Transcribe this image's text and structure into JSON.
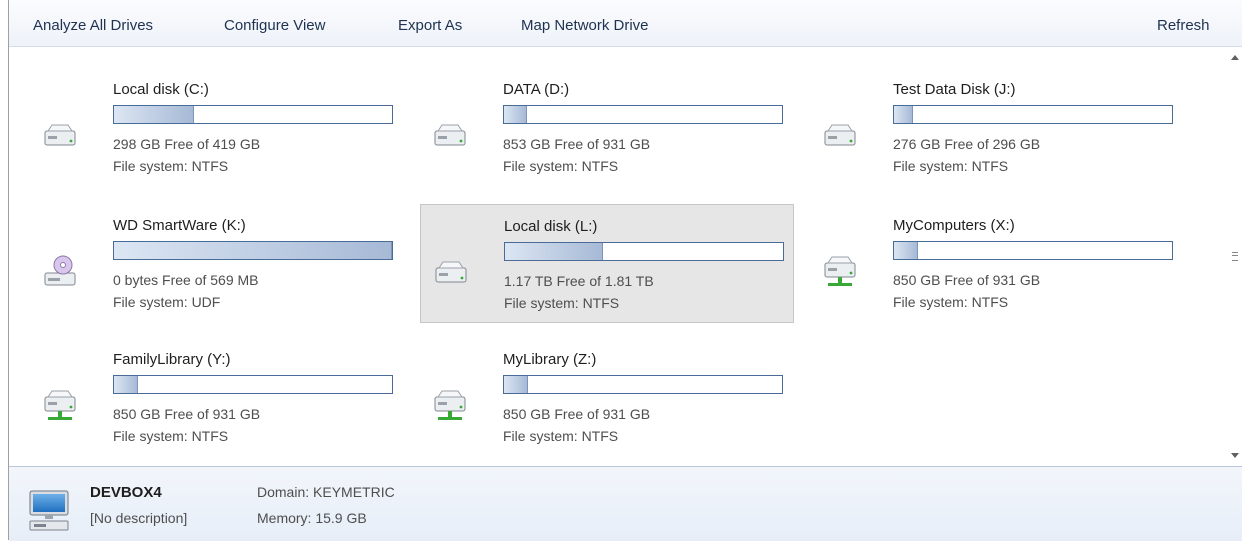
{
  "toolbar": {
    "analyze": "Analyze All Drives",
    "configure": "Configure View",
    "export": "Export As",
    "map": "Map Network Drive",
    "refresh": "Refresh"
  },
  "drives": [
    {
      "name": "Local disk (C:)",
      "free": "298 GB Free of 419 GB",
      "fs": "File system: NTFS",
      "used_fraction": 0.289,
      "icon": "hard-drive-icon"
    },
    {
      "name": "DATA (D:)",
      "free": "853 GB Free of 931 GB",
      "fs": "File system: NTFS",
      "used_fraction": 0.084,
      "icon": "hard-drive-icon"
    },
    {
      "name": "Test Data Disk (J:)",
      "free": "276 GB Free of 296 GB",
      "fs": "File system: NTFS",
      "used_fraction": 0.068,
      "icon": "hard-drive-icon"
    },
    {
      "name": "WD SmartWare (K:)",
      "free": "0 bytes Free of 569 MB",
      "fs": "File system: UDF",
      "used_fraction": 1.0,
      "icon": "optical-drive-icon"
    },
    {
      "name": "Local disk (L:)",
      "free": "1.17 TB Free of 1.81 TB",
      "fs": "File system: NTFS",
      "used_fraction": 0.354,
      "icon": "hard-drive-icon"
    },
    {
      "name": "MyComputers (X:)",
      "free": "850 GB Free of 931 GB",
      "fs": "File system: NTFS",
      "used_fraction": 0.087,
      "icon": "network-drive-icon"
    },
    {
      "name": "FamilyLibrary (Y:)",
      "free": "850 GB Free of 931 GB",
      "fs": "File system: NTFS",
      "used_fraction": 0.087,
      "icon": "network-drive-icon"
    },
    {
      "name": "MyLibrary (Z:)",
      "free": "850 GB Free of 931 GB",
      "fs": "File system: NTFS",
      "used_fraction": 0.087,
      "icon": "network-drive-icon"
    }
  ],
  "selected_drive": "Local disk (L:)",
  "details": {
    "computer_name": "DEVBOX4",
    "description": "[No description]",
    "domain": "Domain: KEYMETRIC",
    "memory": "Memory: 15.9 GB"
  },
  "colors": {
    "bar_border": "#4a6a97",
    "bar_fill_light": "#dce6f3",
    "bar_fill_dark": "#a6b9d6",
    "selection_bg": "#e6e6e6",
    "network_green": "#39a935"
  }
}
